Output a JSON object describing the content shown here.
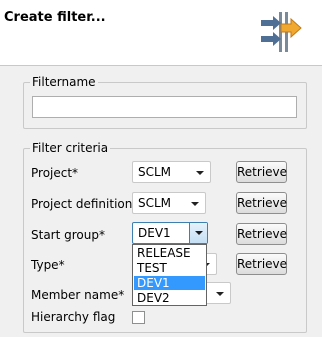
{
  "dialog": {
    "title": "Create filter..."
  },
  "filtername_group": {
    "legend": "Filtername",
    "value": ""
  },
  "criteria_group": {
    "legend": "Filter criteria",
    "project": {
      "label": "Project*",
      "value": "SCLM",
      "button": "Retrieve"
    },
    "project_definition": {
      "label": "Project definition*",
      "value": "SCLM",
      "button": "Retrieve"
    },
    "start_group": {
      "label": "Start group*",
      "value": "DEV1",
      "button": "Retrieve",
      "options": [
        "RELEASE",
        "TEST",
        "DEV1",
        "DEV2"
      ],
      "selected_option": "DEV1"
    },
    "type": {
      "label": "Type*",
      "button": "Retrieve"
    },
    "member_name": {
      "label": "Member name*"
    },
    "hierarchy_flag": {
      "label": "Hierarchy flag",
      "checked": false
    }
  },
  "colors": {
    "accent": "#3399ff",
    "banner_arrow": "#f0a830",
    "border": "#c9c9c9"
  },
  "icons": {
    "banner": "filter-arrows-icon",
    "dropdown": "chevron-down-icon"
  }
}
